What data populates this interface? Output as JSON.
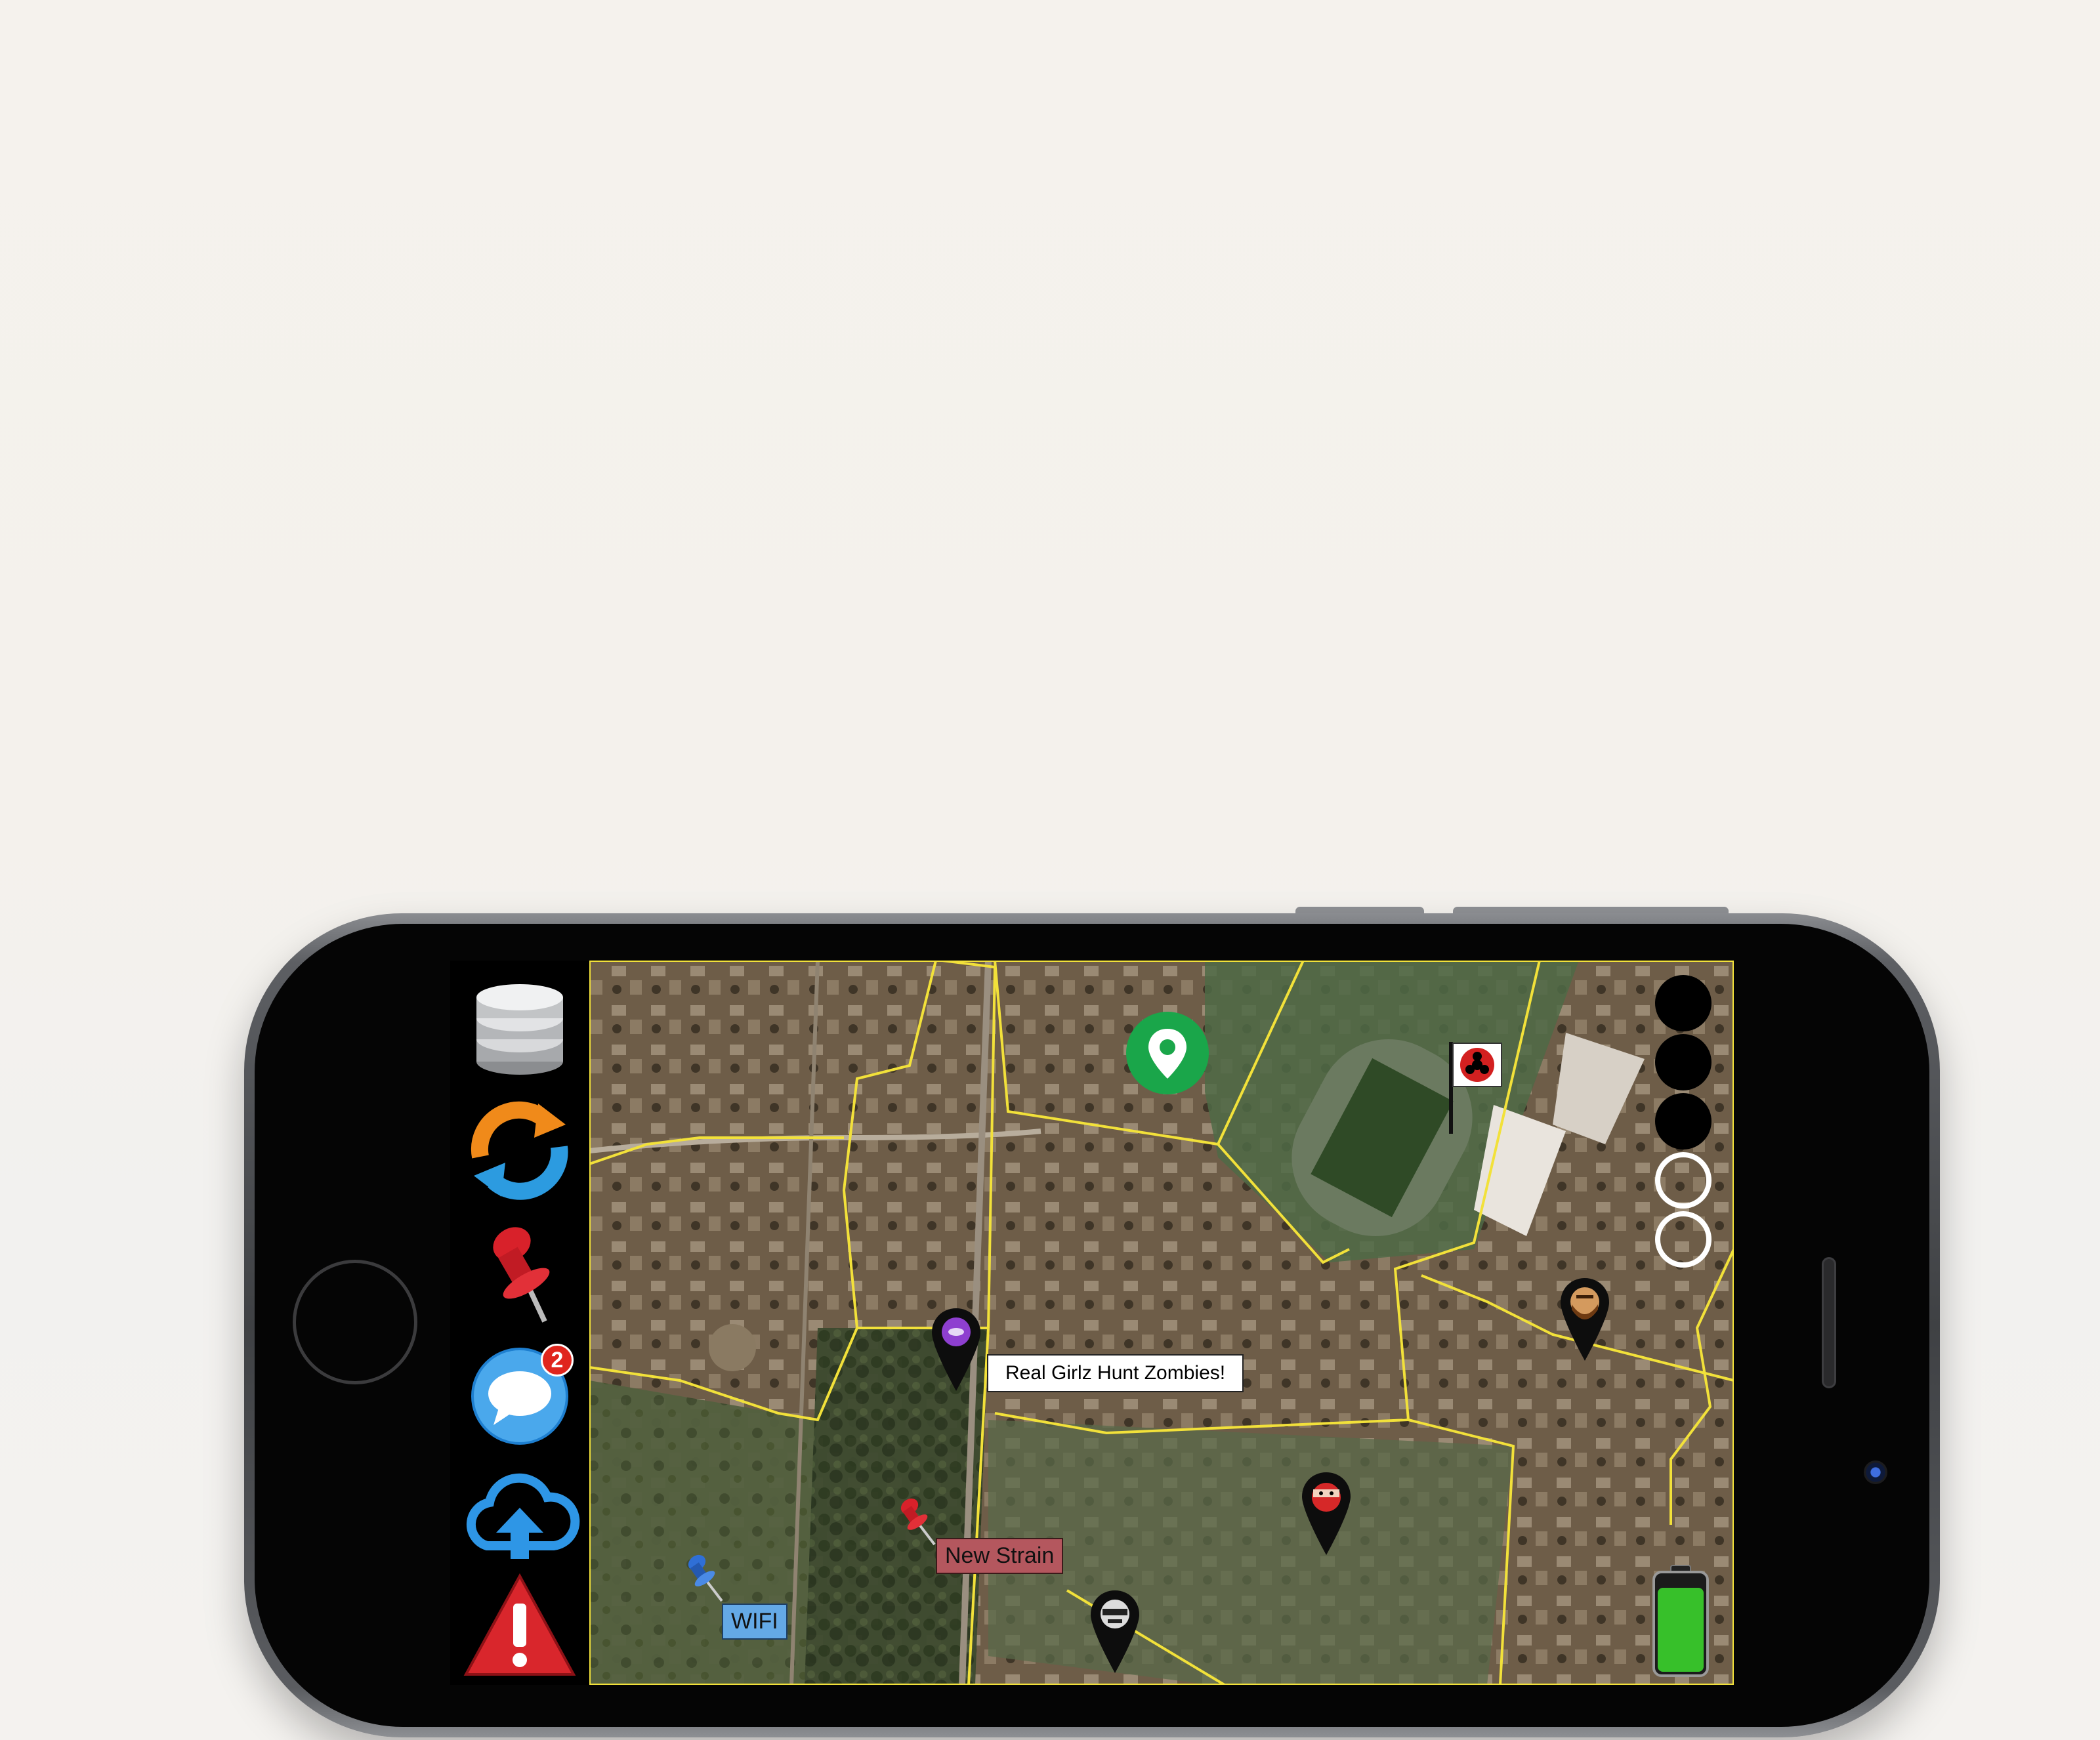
{
  "sidebar": {
    "items": [
      {
        "name": "database-icon"
      },
      {
        "name": "sync-icon"
      },
      {
        "name": "pushpin-icon"
      },
      {
        "name": "chat-icon",
        "badge": "2"
      },
      {
        "name": "cloud-upload-icon"
      },
      {
        "name": "warning-icon"
      }
    ]
  },
  "map": {
    "labels": {
      "speech_bubble": "Real Girlz Hunt Zombies!",
      "new_strain": "New Strain",
      "wifi": "WIFI"
    },
    "markers": [
      {
        "name": "location-pin-icon",
        "color": "#1aa64a"
      },
      {
        "name": "biohazard-flag-icon",
        "color": "#d32020"
      },
      {
        "name": "purple-player-marker",
        "color": "#8e3fd0"
      },
      {
        "name": "bearded-player-marker",
        "color": "#b5651d"
      },
      {
        "name": "red-ninja-player-marker",
        "color": "#d62828"
      },
      {
        "name": "masked-player-marker",
        "color": "#dddddd"
      }
    ]
  },
  "status_dots": {
    "filled": 3,
    "empty": 2
  },
  "battery": {
    "level": 0.85,
    "color": "#37c02a"
  },
  "colors": {
    "boundary": "#f2e13a",
    "sidebar": "#000000"
  }
}
